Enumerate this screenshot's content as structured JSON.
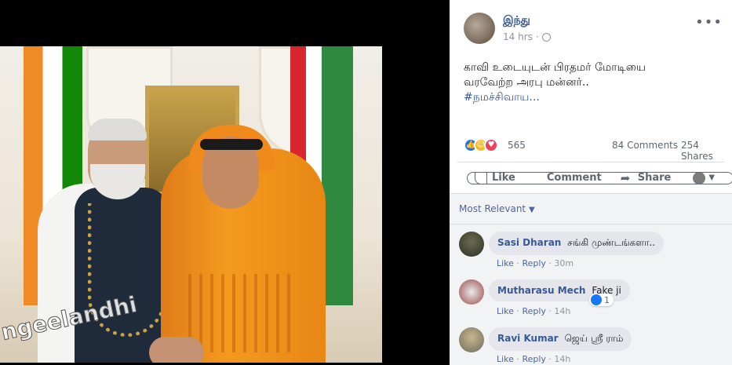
{
  "post": {
    "author": "இந்து",
    "time": "14 hrs",
    "text_line1": "காவி உடையுடன் பிரதமர் மோடியை",
    "text_line2": "வரவேற்ற அரபு மன்னர்..",
    "hashtag": "#நமச்சிவாய..."
  },
  "photo": {
    "watermark": "ngeelandhi"
  },
  "stats": {
    "reaction_count": "565",
    "comments": "84 Comments",
    "shares": "254 Shares"
  },
  "actions": {
    "like": "Like",
    "comment": "Comment",
    "share": "Share"
  },
  "comments_section": {
    "filter": "Most Relevant",
    "items": [
      {
        "name": "Sasi Dharan",
        "text": "சங்கி முண்டங்களா..",
        "like": "Like",
        "reply": "Reply",
        "time": "30m"
      },
      {
        "name": "Mutharasu Mech",
        "text": "Fake ji",
        "like": "Like",
        "reply": "Reply",
        "time": "14h",
        "reactions": "1"
      },
      {
        "name": "Ravi Kumar",
        "text": "ஜெய் ஸ்ரீ ராம்",
        "like": "Like",
        "reply": "Reply",
        "time": "14h"
      }
    ]
  },
  "colors": {
    "link_blue": "#385898",
    "like_blue": "#1877f2",
    "saffron": "#f39a1e"
  }
}
